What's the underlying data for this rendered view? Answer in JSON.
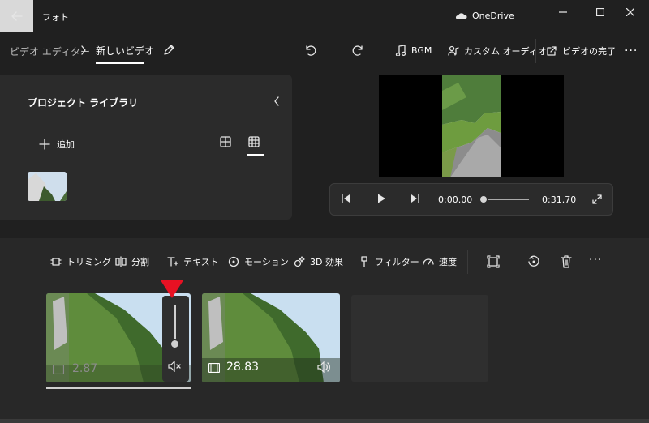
{
  "window": {
    "app_title": "フォト",
    "onedrive_label": "OneDrive"
  },
  "header": {
    "breadcrumb_root": "ビデオ エディター",
    "breadcrumb_current": "新しいビデオ",
    "commands": {
      "bgm": "BGM",
      "custom_audio": "カスタム オーディオ",
      "finish_video": "ビデオの完了",
      "more": "···"
    }
  },
  "library": {
    "title": "プロジェクト ライブラリ",
    "add_label": "追加"
  },
  "player": {
    "current_time": "0:00.00",
    "total_time": "0:31.70",
    "progress": 0
  },
  "storyboard": {
    "tools": {
      "trim": "トリミング",
      "split": "分割",
      "text": "テキスト",
      "motion": "モーション",
      "effects_3d": "3D 効果",
      "filters": "フィルター",
      "speed": "速度",
      "more": "···"
    },
    "clips": [
      {
        "duration": "2.87",
        "muted": true,
        "volume_level": 0
      },
      {
        "duration": "28.83",
        "muted": false
      },
      {
        "empty": true
      }
    ]
  },
  "colors": {
    "background": "#202020",
    "panel": "#2b2b2b",
    "marker": "#e81123"
  }
}
